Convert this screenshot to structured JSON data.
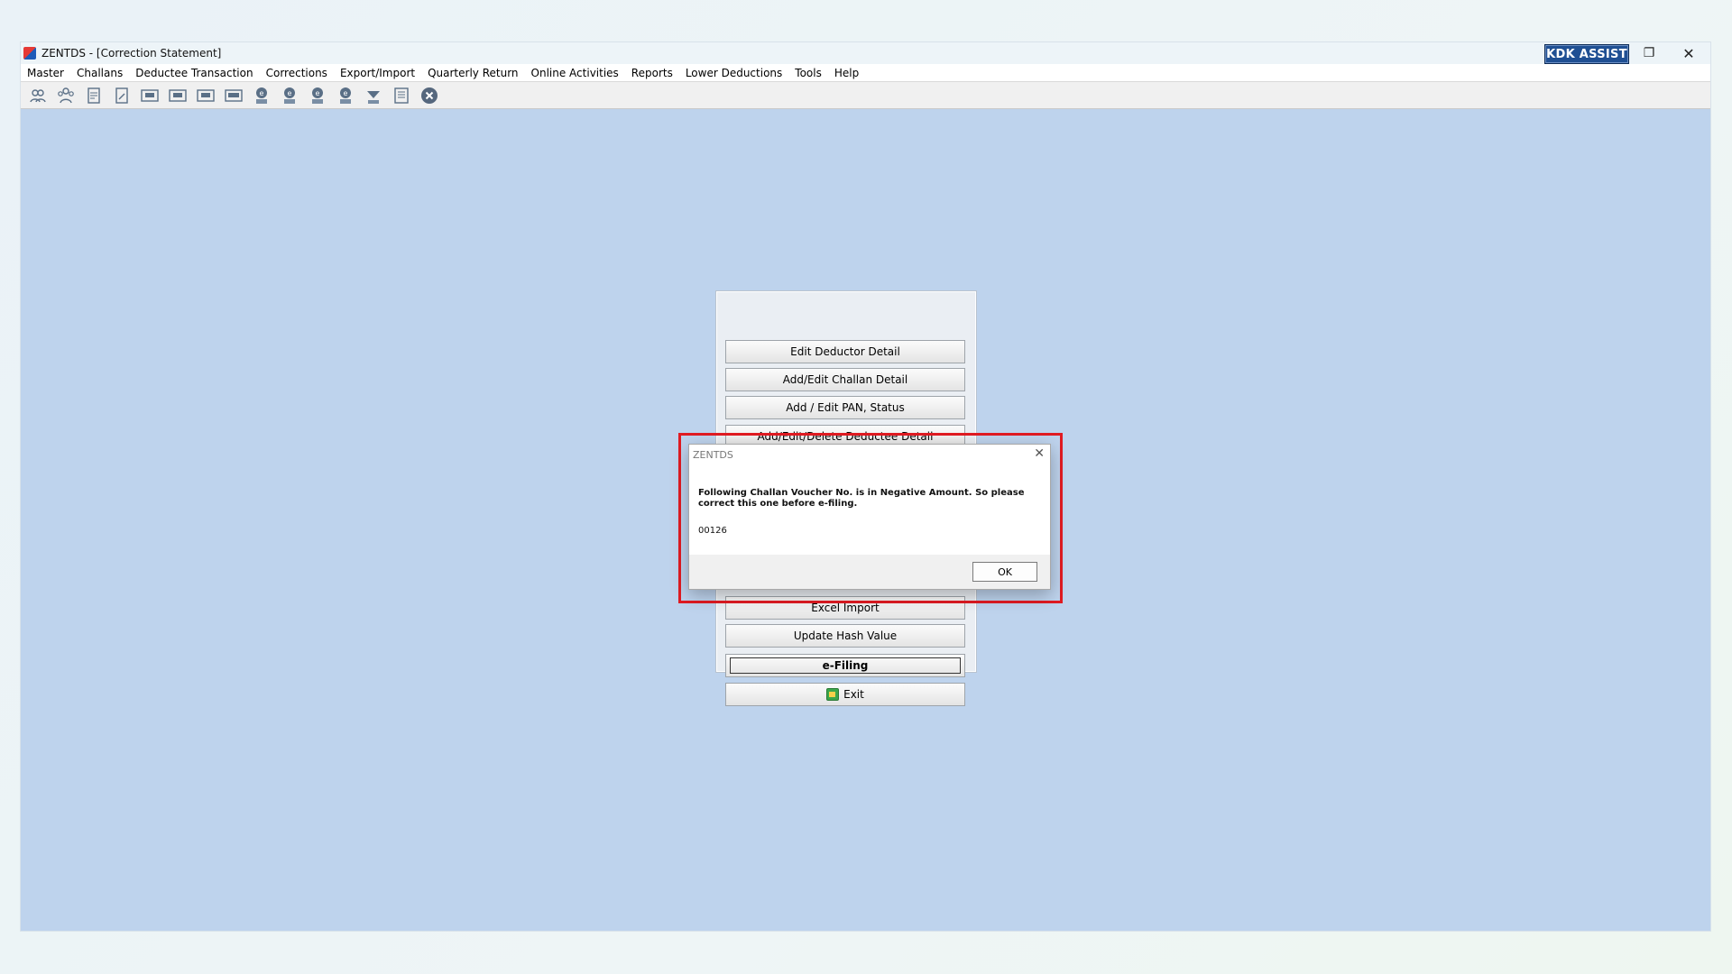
{
  "window": {
    "title": "ZENTDS - [Correction Statement]",
    "controls": {
      "minimize": "–",
      "restore": "❐",
      "close": "✕"
    }
  },
  "menu": [
    "Master",
    "Challans",
    "Deductee Transaction",
    "Corrections",
    "Export/Import",
    "Quarterly Return",
    "Online Activities",
    "Reports",
    "Lower Deductions",
    "Tools",
    "Help"
  ],
  "toolbar": {
    "icons": [
      "users-icon",
      "users-group-icon",
      "form-icon",
      "form-edit-icon",
      "form-24q-icon",
      "form-26q-icon",
      "form-27q-icon",
      "form-27eq-icon",
      "e-24q-icon",
      "e-26q-icon",
      "e-27q-icon",
      "e-27eq-icon",
      "tds-icon",
      "notepad-icon",
      "close-circle-icon"
    ],
    "brand_label": "KDK ASSIST"
  },
  "panel": {
    "buttons": [
      "Edit Deductor Detail",
      "Add/Edit Challan Detail",
      "Add / Edit PAN, Status",
      "Add/Edit/Delete Deductee Detail",
      "Excel Import",
      "Update Hash Value",
      "e-Filing",
      "Exit"
    ]
  },
  "dialog": {
    "title": "ZENTDS",
    "message": "Following Challan Voucher No. is in Negative Amount. So please correct this one before e-filing.",
    "voucher": "00126",
    "ok_label": "OK"
  },
  "colors": {
    "workspace": "#bed3ed",
    "highlight": "#e11b22",
    "brand": "#1f4f93"
  }
}
